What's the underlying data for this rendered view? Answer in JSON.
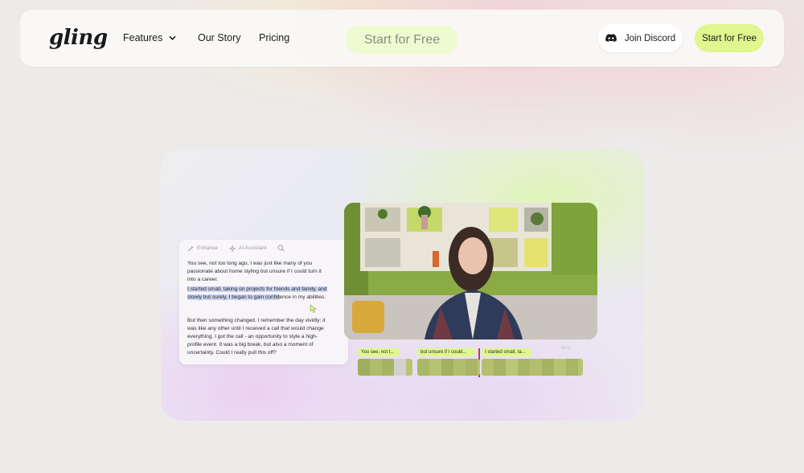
{
  "nav": {
    "logo": "gling",
    "features": "Features",
    "our_story": "Our Story",
    "pricing": "Pricing",
    "cta_center": "Start for Free",
    "join_discord": "Join Discord",
    "cta_right": "Start for Free"
  },
  "editor": {
    "toolbar": {
      "enhance": "Enhance",
      "ai_assistant": "AI Assistant"
    },
    "para1": "You see, not too long ago, I was just like many of you passionate about home styling but unsure if I could turn it into a career.",
    "para2_highlight": "I started small, taking on projects for friends and family, and slowly but surely, I began to gain confid",
    "para2_rest": "ence in my abilities.",
    "para2_tail": "",
    "para3": "But then something changed. I remember the day vividly; it was like any other until I received a call that would change everything. I got the call - an opportunity to style a high-profile event. It was a big break, but also a moment of uncertainty. Could I really pull this off?"
  },
  "timeline": {
    "labels": [
      "You see, not t...",
      "but unsure if I could...",
      "I started small, ta..."
    ],
    "timestamp": "00:11"
  },
  "colors": {
    "accent": "#dff78e",
    "nav_bg": "#faf8f6",
    "page_bg": "#ecebea",
    "highlight": "#c8d3f0"
  }
}
